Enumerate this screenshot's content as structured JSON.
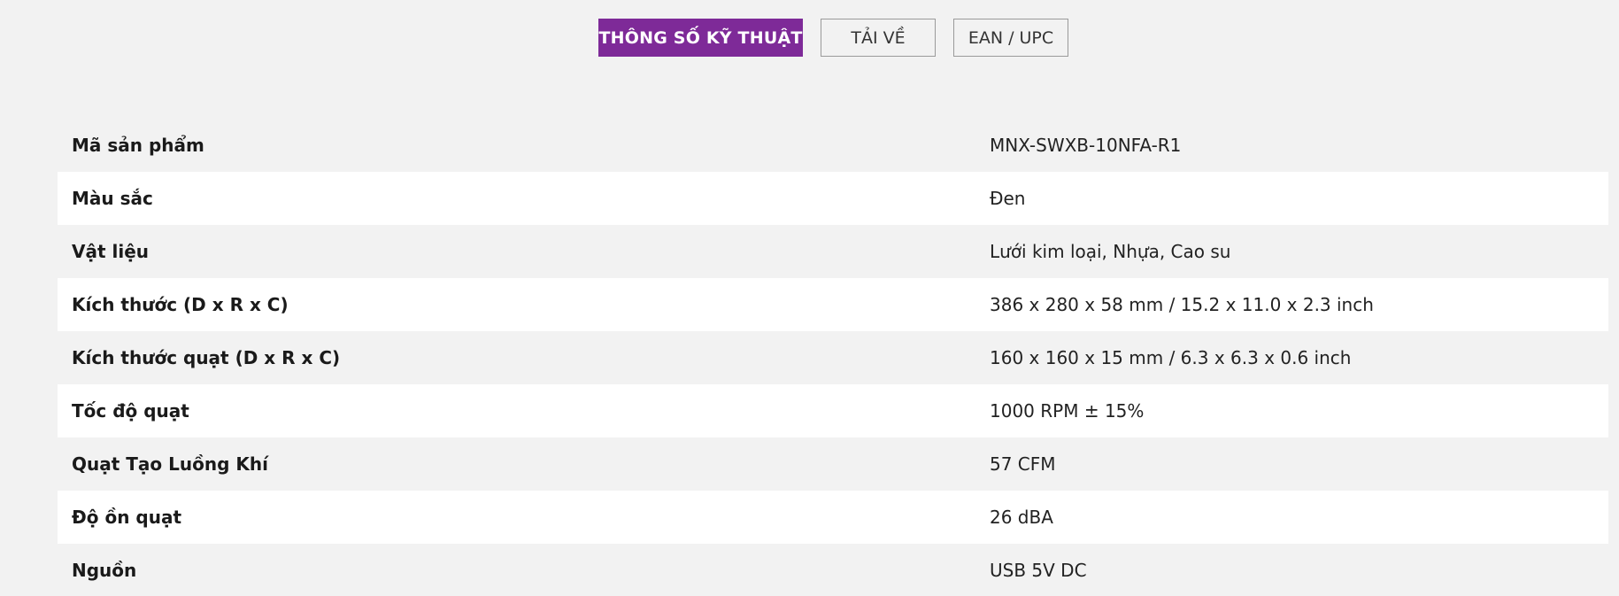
{
  "tabs": {
    "specs": "THÔNG SỐ KỸ THUẬT",
    "download": "TẢI VỀ",
    "ean": "EAN / UPC"
  },
  "colors": {
    "accent": "#7e2a98",
    "page_bg": "#f2f2f2",
    "row_alt_bg": "#ffffff"
  },
  "specs": [
    {
      "label": "Mã sản phẩm",
      "value": "MNX-SWXB-10NFA-R1"
    },
    {
      "label": "Màu sắc",
      "value": "Đen"
    },
    {
      "label": "Vật liệu",
      "value": "Lưới kim loại, Nhựa, Cao su"
    },
    {
      "label": "Kích thước (D x R x C)",
      "value": "386 x 280 x 58 mm / 15.2 x 11.0 x 2.3 inch"
    },
    {
      "label": "Kích thước quạt (D x R x C)",
      "value": "160 x 160 x 15 mm / 6.3 x 6.3 x 0.6 inch"
    },
    {
      "label": "Tốc độ quạt",
      "value": "1000 RPM ± 15%"
    },
    {
      "label": "Quạt Tạo Luồng Khí",
      "value": "57 CFM"
    },
    {
      "label": "Độ ồn quạt",
      "value": "26 dBA"
    },
    {
      "label": "Nguồn",
      "value": "USB 5V DC"
    }
  ]
}
